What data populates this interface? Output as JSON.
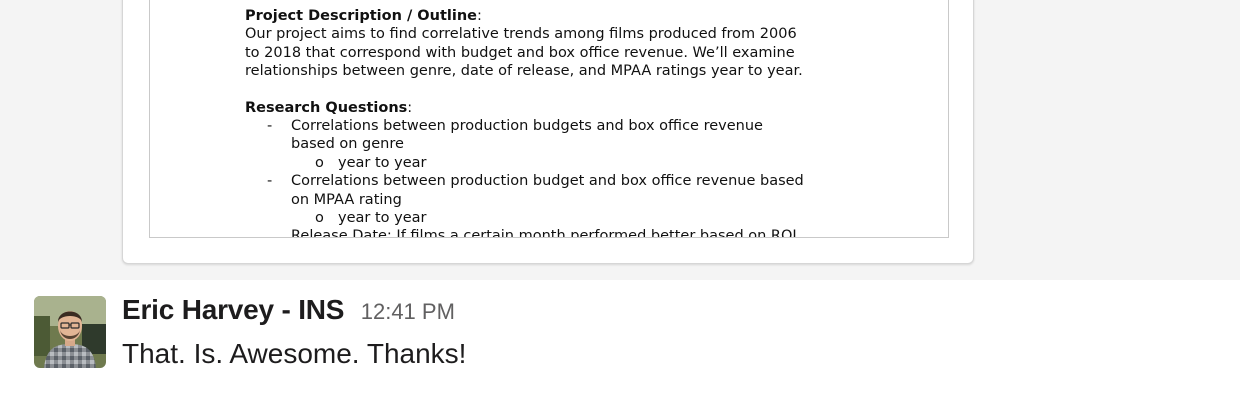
{
  "attachment": {
    "heading1": "Project Description / Outline",
    "heading_colon": ":",
    "paragraph_lines": [
      "Our project aims to find correlative trends among films produced from 2006",
      "to 2018 that correspond with budget and box office revenue. We’ll examine",
      "relationships between genre, date of release, and MPAA ratings year to year."
    ],
    "heading2": "Research Questions",
    "bullet_marker": "-",
    "sub_marker": "o",
    "bullets": [
      {
        "lines": [
          "Correlations between production budgets and box office revenue",
          "based on genre"
        ],
        "sub": "year to year"
      },
      {
        "lines": [
          "Correlations between production budget and box office revenue based",
          "on MPAA rating"
        ],
        "sub": "year to year"
      },
      {
        "lines": [
          "Release Date: If films a certain month performed better based on ROI"
        ]
      }
    ]
  },
  "message": {
    "sender": "Eric Harvey - INS",
    "timestamp": "12:41 PM",
    "text": "That. Is. Awesome. Thanks!",
    "avatar_icon": "user-avatar-photo"
  }
}
